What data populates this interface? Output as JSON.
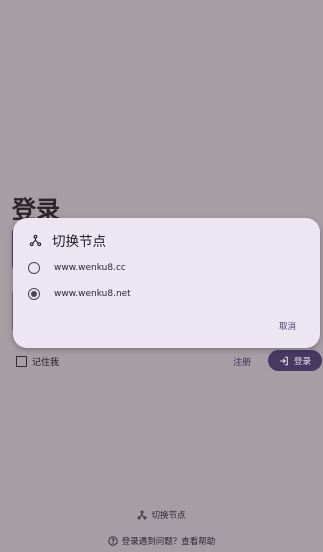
{
  "login": {
    "title": "登录",
    "remember_label": "记住我",
    "register_label": "注册",
    "login_button_label": "登录",
    "switch_node_label": "切换节点",
    "help_label": "登录遇到问题？查看帮助"
  },
  "dialog": {
    "title": "切换节点",
    "options": [
      {
        "label": "www.wenku8.cc",
        "selected": false
      },
      {
        "label": "www.wenku8.net",
        "selected": true
      }
    ],
    "cancel_label": "取消"
  },
  "colors": {
    "scrim": "#a59ea5",
    "dialog_bg": "#ece6f2",
    "primary": "#463a64"
  }
}
